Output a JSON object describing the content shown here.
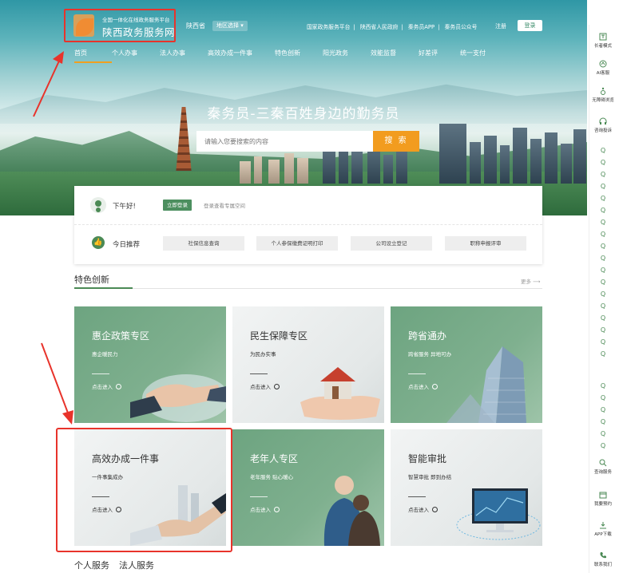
{
  "header": {
    "logo_sub": "全国一体化在线政务服务平台",
    "logo_title": "陕西政务服务网",
    "region": "陕西省",
    "region_button": "地区选择",
    "top_links": [
      "国家政务服务平台",
      "陕西省人民政府",
      "秦务员APP",
      "秦务员公众号"
    ],
    "register": "注册",
    "login": "登录"
  },
  "nav": {
    "items": [
      "首页",
      "个人办事",
      "法人办事",
      "高效办成一件事",
      "特色创新",
      "阳光政务",
      "效能监督",
      "好差评",
      "统一支付"
    ],
    "active_index": 0
  },
  "hero": {
    "slogan": "秦务员-三秦百姓身边的勤务员",
    "search_placeholder": "请输入您要搜索的内容",
    "search_button": "搜 索"
  },
  "user_card": {
    "greeting": "下午好!",
    "login_button": "立即登录",
    "login_hint": "登录查看专属空间",
    "recommend_label": "今日推荐",
    "recommend": [
      "社保信息查询",
      "个人参保缴费证明打印",
      "公司设立登记",
      "职称申报评审"
    ]
  },
  "feature": {
    "title": "特色创新",
    "more": "更多",
    "tiles": [
      {
        "title": "惠企政策专区",
        "sub": "惠企暖民力",
        "enter": "点击进入",
        "style": "green"
      },
      {
        "title": "民生保障专区",
        "sub": "为民办实事",
        "enter": "点击进入",
        "style": "gray"
      },
      {
        "title": "跨省通办",
        "sub": "跨省服务  异地可办",
        "enter": "点击进入",
        "style": "green"
      },
      {
        "title": "高效办成一件事",
        "sub": "一件事集成办",
        "enter": "点击进入",
        "style": "gray"
      },
      {
        "title": "老年人专区",
        "sub": "老年服务  贴心暖心",
        "enter": "点击进入",
        "style": "green"
      },
      {
        "title": "智能审批",
        "sub": "智慧审批  即到办结",
        "enter": "点击进入",
        "style": "gray"
      }
    ]
  },
  "bottom_tabs": [
    "个人服务",
    "法人服务"
  ],
  "sidebar": {
    "items": [
      {
        "label": "长者模式",
        "icon": "elder-mode-icon"
      },
      {
        "label": "AI客服",
        "icon": "ai-service-icon"
      },
      {
        "label": "无障碍浏览",
        "icon": "accessibility-icon"
      },
      {
        "label": "咨询投诉",
        "icon": "headset-icon"
      },
      {
        "label": "查询服务",
        "icon": "search-service-icon"
      },
      {
        "label": "我要预约",
        "icon": "calendar-icon"
      },
      {
        "label": "APP下载",
        "icon": "download-icon"
      },
      {
        "label": "联系我们",
        "icon": "phone-icon"
      }
    ]
  },
  "colors": {
    "brand_green": "#4b8a55",
    "accent_orange": "#f29c1f",
    "highlight_red": "#e8332b"
  }
}
